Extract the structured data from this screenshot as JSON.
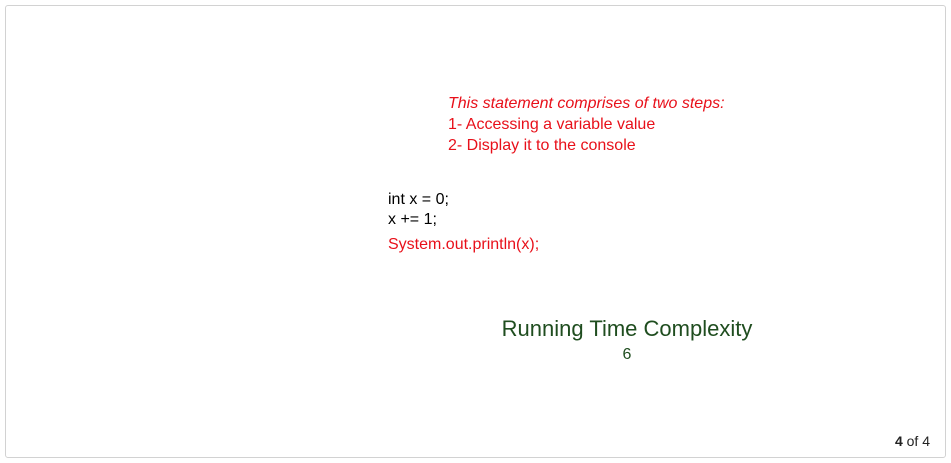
{
  "note": {
    "heading": "This statement comprises of two steps:",
    "step1": "1- Accessing a variable value",
    "step2": "2- Display it to the console"
  },
  "code": {
    "line1": "int x = 0;",
    "line2": "x += 1;",
    "line3": "System.out.println(x);"
  },
  "footer": {
    "title": "Running Time Complexity",
    "page_number": "6"
  },
  "slide_counter": {
    "current": "4",
    "separator": " of ",
    "total": "4"
  },
  "colors": {
    "highlight": "#e8101a",
    "footer_text": "#1f4d1f",
    "frame_border": "#d2d2d2"
  }
}
